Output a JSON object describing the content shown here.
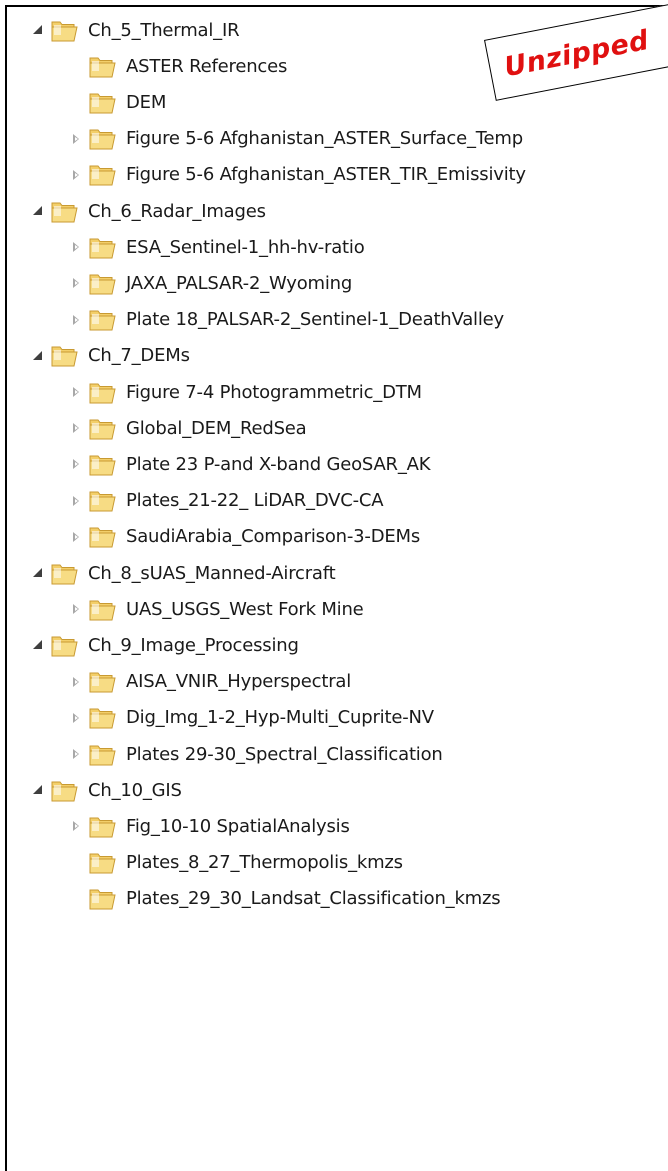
{
  "callout": {
    "text": "Unzipped"
  },
  "colors": {
    "folder_body": "#f3cf6a",
    "folder_front": "#f7dc84",
    "folder_shadow": "#c89a32",
    "callout_text": "#e01010"
  },
  "icons": {
    "folder": "folder-icon",
    "expanded": "expanded-arrow-icon",
    "collapsed": "collapsed-arrow-icon"
  },
  "tree": [
    {
      "label": "Ch_5_Thermal_IR",
      "level": 0,
      "state": "expanded"
    },
    {
      "label": "ASTER References",
      "level": 1,
      "state": "none"
    },
    {
      "label": "DEM",
      "level": 1,
      "state": "none"
    },
    {
      "label": "Figure 5-6 Afghanistan_ASTER_Surface_Temp",
      "level": 1,
      "state": "collapsed"
    },
    {
      "label": "Figure 5-6 Afghanistan_ASTER_TIR_Emissivity",
      "level": 1,
      "state": "collapsed"
    },
    {
      "label": "Ch_6_Radar_Images",
      "level": 0,
      "state": "expanded"
    },
    {
      "label": "ESA_Sentinel-1_hh-hv-ratio",
      "level": 1,
      "state": "collapsed"
    },
    {
      "label": "JAXA_PALSAR-2_Wyoming",
      "level": 1,
      "state": "collapsed"
    },
    {
      "label": "Plate 18_PALSAR-2_Sentinel-1_DeathValley",
      "level": 1,
      "state": "collapsed"
    },
    {
      "label": "Ch_7_DEMs",
      "level": 0,
      "state": "expanded"
    },
    {
      "label": "Figure 7-4 Photogrammetric_DTM",
      "level": 1,
      "state": "collapsed"
    },
    {
      "label": "Global_DEM_RedSea",
      "level": 1,
      "state": "collapsed"
    },
    {
      "label": "Plate 23 P-and X-band GeoSAR_AK",
      "level": 1,
      "state": "collapsed"
    },
    {
      "label": "Plates_21-22_ LiDAR_DVC-CA",
      "level": 1,
      "state": "collapsed"
    },
    {
      "label": "SaudiArabia_Comparison-3-DEMs",
      "level": 1,
      "state": "collapsed"
    },
    {
      "label": "Ch_8_sUAS_Manned-Aircraft",
      "level": 0,
      "state": "expanded"
    },
    {
      "label": "UAS_USGS_West Fork Mine",
      "level": 1,
      "state": "collapsed"
    },
    {
      "label": "Ch_9_Image_Processing",
      "level": 0,
      "state": "expanded"
    },
    {
      "label": "AISA_VNIR_Hyperspectral",
      "level": 1,
      "state": "collapsed"
    },
    {
      "label": "Dig_Img_1-2_Hyp-Multi_Cuprite-NV",
      "level": 1,
      "state": "collapsed"
    },
    {
      "label": "Plates 29-30_Spectral_Classification",
      "level": 1,
      "state": "collapsed"
    },
    {
      "label": "Ch_10_GIS",
      "level": 0,
      "state": "expanded"
    },
    {
      "label": "Fig_10-10 SpatialAnalysis",
      "level": 1,
      "state": "collapsed"
    },
    {
      "label": "Plates_8_27_Thermopolis_kmzs",
      "level": 1,
      "state": "none"
    },
    {
      "label": "Plates_29_30_Landsat_Classification_kmzs",
      "level": 1,
      "state": "none"
    }
  ]
}
